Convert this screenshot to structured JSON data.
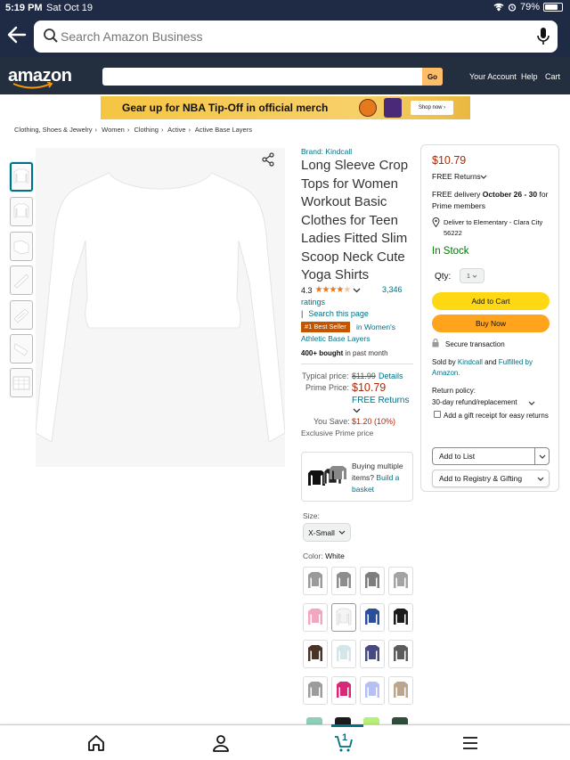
{
  "status_bar": {
    "time": "5:19 PM",
    "date": "Sat Oct 19",
    "battery": "79%",
    "battery_level": 0.79
  },
  "browser_search": {
    "placeholder": "Search Amazon Business"
  },
  "header": {
    "logo": "amazon",
    "go_label": "Go",
    "nav": [
      "Your Account",
      "Help",
      "Cart"
    ]
  },
  "promo": {
    "text": "Gear up for NBA Tip-Off in official merch",
    "shop_label": "Shop now ›"
  },
  "breadcrumb": [
    "Clothing, Shoes & Jewelry",
    "Women",
    "Clothing",
    "Active",
    "Active Base Layers"
  ],
  "product": {
    "brand": "Brand: Kindcall",
    "title": "Long Sleeve Crop Tops for Women Workout Basic Clothes for Teen Ladies Fitted Slim Scoop Neck Cute Yoga Shirts",
    "rating": "4.3",
    "stars": 4.3,
    "ratings_count": "3,346",
    "ratings_word": "ratings",
    "search_page": "Search this page",
    "best_seller_badge": "#1 Best Seller",
    "best_seller_in": "in Women's",
    "best_seller_category": "Athletic Base Layers",
    "bought_bold": "400+ bought",
    "bought_rest": "in past month",
    "typical_label": "Typical price:",
    "typical_price": "$11.99",
    "details": "Details",
    "prime_label": "Prime Price:",
    "prime_price": "$10.79",
    "free_returns": "FREE Returns",
    "you_save_label": "You Save:",
    "you_save": "$1.20 (10%)",
    "exclusive": "Exclusive Prime price",
    "multi_text": "Buying multiple items?",
    "multi_link": "Build a basket",
    "size_label": "Size:",
    "size_value": "X-Small",
    "color_label": "Color:",
    "color_value": "White",
    "swatch_colors": [
      "#9a9a9a",
      "#8d8d8d",
      "#7d7d7d",
      "#a3a3a3",
      "#f0a7c2",
      "#f4f4f4",
      "#2b4e9a",
      "#1a1a1a",
      "#4a3327",
      "#d5e6ea",
      "#474a80",
      "#5b5b5b",
      "#9c9c9c",
      "#d8287a",
      "#b6c0f2",
      "#bba58e"
    ]
  },
  "buy_box": {
    "price": "$10.79",
    "free_returns": "FREE Returns",
    "delivery_prefix": "FREE delivery",
    "delivery_dates": "October 26 - 30",
    "delivery_suffix": "for Prime members",
    "deliver_to": "Deliver to Elementary - Clara City 56222",
    "stock": "In Stock",
    "qty_label": "Qty:",
    "qty_value": "1",
    "add_to_cart": "Add to Cart",
    "buy_now": "Buy Now",
    "secure": "Secure transaction",
    "sold_by_prefix": "Sold by",
    "sold_by": "Kindcall",
    "fulfilled_and": "and",
    "fulfilled_by": "Fulfilled by Amazon.",
    "return_policy_label": "Return policy:",
    "return_policy": "30-day refund/replacement",
    "gift_receipt": "Add a gift receipt for easy returns",
    "add_to_list": "Add to List",
    "add_to_registry": "Add to Registry & Gifting"
  },
  "tab_bar": {
    "cart_count": "1"
  },
  "colors": {
    "accent_teal": "#007185",
    "price_red": "#b12704",
    "stock_green": "#007600",
    "amazon_dark": "#232f3e"
  }
}
